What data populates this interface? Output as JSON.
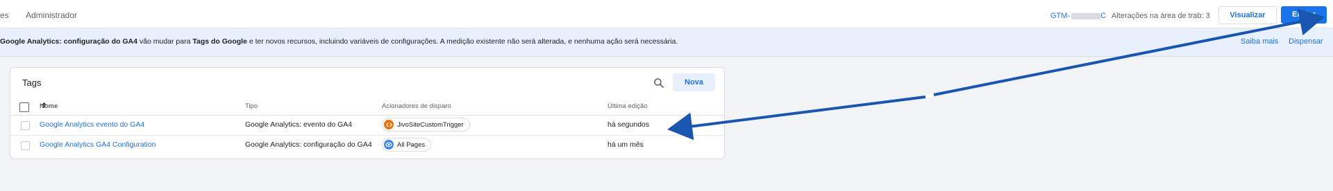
{
  "topbar": {
    "nav_partial": "es",
    "nav_admin": "Administrador",
    "container_id": "GTM-",
    "container_id_tail": "C",
    "changes": "Alterações na área de trab: 3",
    "preview_label": "Visualizar",
    "submit_label": "Enviar"
  },
  "banner": {
    "bold1": "Google Analytics: configuração do GA4",
    "text1": " vão mudar para ",
    "bold2": "Tags do Google",
    "text2": " e ter novos recursos, incluindo variáveis de configurações. A medição existente não será alterada, e nenhuma ação será necessária.",
    "learn_more": "Saiba mais",
    "dismiss": "Dispensar"
  },
  "tags": {
    "title": "Tags",
    "new_label": "Nova",
    "columns": {
      "name": "Nome",
      "sort_icon": "arrow-up-icon",
      "type": "Tipo",
      "triggers": "Acionadores de disparo",
      "last_edit": "Última edição"
    },
    "rows": [
      {
        "name": "Google Analytics evento do GA4",
        "type": "Google Analytics: evento do GA4",
        "trigger": "JivoSiteCustomTrigger",
        "trigger_icon": "code-icon",
        "trigger_color": "#e8710a",
        "last_edit": "há segundos"
      },
      {
        "name": "Google Analytics GA4 Configuration",
        "type": "Google Analytics: configuração do GA4",
        "trigger": "All Pages",
        "trigger_icon": "eye-icon",
        "trigger_color": "#4285f4",
        "last_edit": "há um mês"
      }
    ]
  },
  "colors": {
    "accent": "#1a73e8",
    "banner_bg": "#e8f0fe",
    "annotation_arrow": "#1a56b0"
  }
}
